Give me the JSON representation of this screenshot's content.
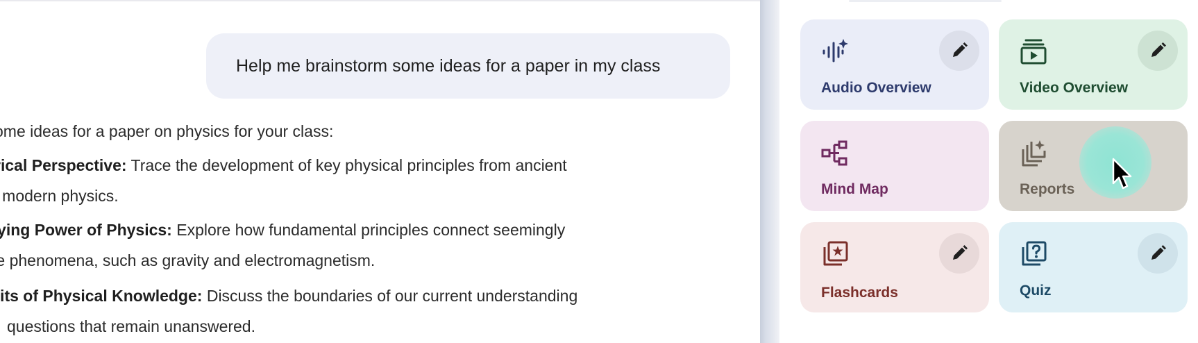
{
  "chat": {
    "user_message": "Help me brainstorm some ideas for a paper in my class",
    "response": {
      "intro": "ome ideas for a paper on physics for your class:",
      "items": [
        {
          "title": "orical Perspective:",
          "text": " Trace the development of key physical principles from ancient",
          "continuation": "o modern physics."
        },
        {
          "title": "ifying Power of Physics:",
          "text": " Explore how fundamental principles connect seemingly",
          "continuation": "te phenomena, such as gravity and electromagnetism."
        },
        {
          "title": "nits of Physical Knowledge:",
          "text": " Discuss the boundaries of our current understanding",
          "continuation": "questions that remain unanswered."
        }
      ]
    }
  },
  "studio": {
    "cards": [
      {
        "label": "Audio Overview",
        "icon": "audio-waveform-icon",
        "color": "#eaedf8"
      },
      {
        "label": "Video Overview",
        "icon": "video-stack-icon",
        "color": "#dff2e5"
      },
      {
        "label": "Mind Map",
        "icon": "mind-map-icon",
        "color": "#f3e6f1"
      },
      {
        "label": "Reports",
        "icon": "reports-icon",
        "color": "#d7d3cc"
      },
      {
        "label": "Flashcards",
        "icon": "flashcards-icon",
        "color": "#f6e8e8"
      },
      {
        "label": "Quiz",
        "icon": "quiz-icon",
        "color": "#dff0f6"
      }
    ],
    "edit_icon": "pencil-icon"
  }
}
